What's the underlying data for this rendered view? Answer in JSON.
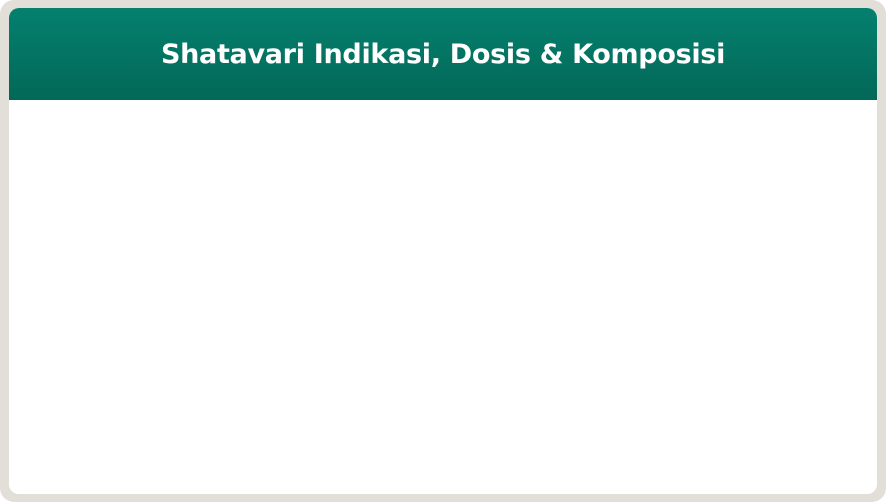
{
  "panel": {
    "title": "Shatavari Indikasi, Dosis & Komposisi"
  },
  "colors": {
    "header_top": "#04806f",
    "header_bottom": "#036857",
    "frame": "#e2dfd9",
    "body": "#ffffff",
    "title_text": "#ffffff"
  }
}
